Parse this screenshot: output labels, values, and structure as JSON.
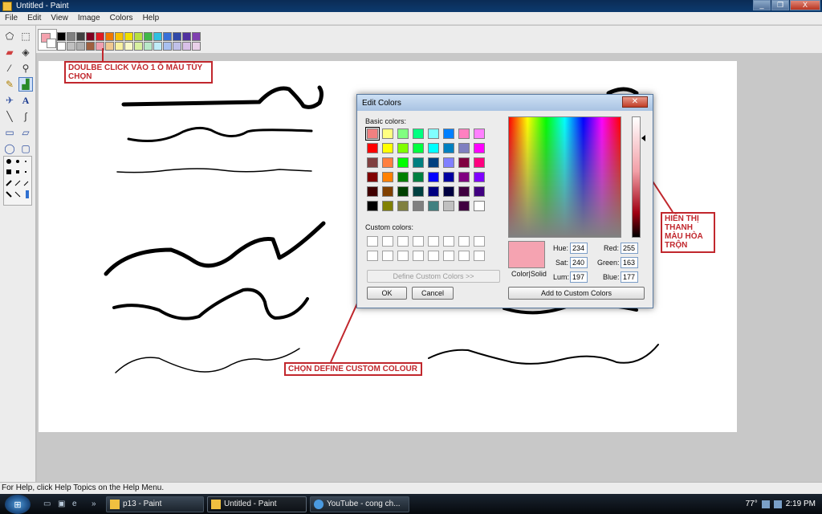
{
  "window": {
    "title": "Untitled - Paint",
    "buttons": [
      "_",
      "❐",
      "X"
    ]
  },
  "menu": [
    "File",
    "Edit",
    "View",
    "Image",
    "Colors",
    "Help"
  ],
  "palette": {
    "top_row": [
      "#000000",
      "#808080",
      "#404040",
      "#800020",
      "#e01b24",
      "#f07800",
      "#f8c000",
      "#f0e000",
      "#b8e040",
      "#40b848",
      "#30c0e0",
      "#3870d8",
      "#3048a8",
      "#5030a0",
      "#8040b0"
    ],
    "bottom_row": [
      "#ffffff",
      "#c0c0c0",
      "#b0b0b0",
      "#a06040",
      "#f0a0b0",
      "#f0c890",
      "#f8f0a0",
      "#f8f8c8",
      "#d8f0a0",
      "#b8e8c8",
      "#c0ecf8",
      "#a8c0f0",
      "#c0c0e8",
      "#d8c0e8",
      "#e8d0e8"
    ],
    "foreground": "#f4a2ae",
    "background": "#ffffff"
  },
  "annotations": {
    "double_click": "DOULBE CLICK VÀO 1 Ô MÀU TÙY CHỌN",
    "define_custom": "CHỌN DEFINE CUSTOM COLOUR",
    "mix_bar": "HIỂN THỊ THANH MÀU HÒA TRỘN"
  },
  "dialog": {
    "title": "Edit Colors",
    "basic_label": "Basic colors:",
    "custom_label": "Custom colors:",
    "basic_colors": [
      "#f08080",
      "#ffff80",
      "#80ff80",
      "#00ff80",
      "#80ffff",
      "#0080ff",
      "#ff80c0",
      "#ff80ff",
      "#ff0000",
      "#ffff00",
      "#80ff00",
      "#00ff40",
      "#00ffff",
      "#0080c0",
      "#8080c0",
      "#ff00ff",
      "#804040",
      "#ff8040",
      "#00ff00",
      "#008080",
      "#004080",
      "#8080ff",
      "#800040",
      "#ff0080",
      "#800000",
      "#ff8000",
      "#008000",
      "#008040",
      "#0000ff",
      "#0000a0",
      "#800080",
      "#8000ff",
      "#400000",
      "#804000",
      "#004000",
      "#004040",
      "#000080",
      "#000040",
      "#400040",
      "#400080",
      "#000000",
      "#808000",
      "#808040",
      "#808080",
      "#408080",
      "#c0c0c0",
      "#400040",
      "#ffffff"
    ],
    "define_custom_button": "Define Custom Colors >>",
    "ok_button": "OK",
    "cancel_button": "Cancel",
    "preview_label": "Color|Solid",
    "preview_color": "#f5a3b1",
    "fields": {
      "hue_label": "Hue:",
      "hue": "234",
      "sat_label": "Sat:",
      "sat": "240",
      "lum_label": "Lum:",
      "lum": "197",
      "red_label": "Red:",
      "red": "255",
      "green_label": "Green:",
      "green": "163",
      "blue_label": "Blue:",
      "blue": "177"
    },
    "add_custom_button": "Add to Custom Colors"
  },
  "status": "For Help, click Help Topics on the Help Menu.",
  "taskbar": {
    "tasks": [
      "p13 - Paint",
      "Untitled - Paint",
      "YouTube - cong ch..."
    ],
    "temperature": "77°",
    "clock": "2:19 PM"
  }
}
